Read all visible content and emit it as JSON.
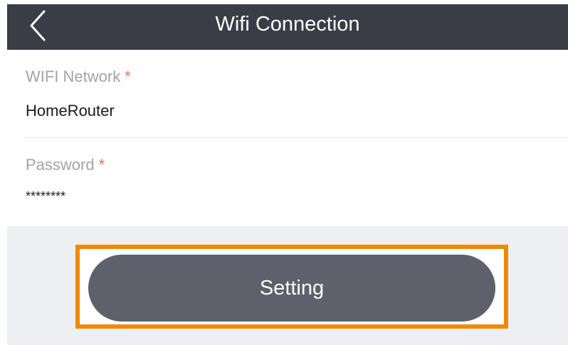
{
  "header": {
    "title": "Wifi Connection",
    "back_icon": "chevron-left-icon",
    "background_color": "#3a3d45"
  },
  "form": {
    "wifi": {
      "label": "WIFI Network",
      "required_mark": "*",
      "value": "HomeRouter"
    },
    "password": {
      "label": "Password",
      "required_mark": "*",
      "value": "********"
    },
    "required_color": "#e8764a"
  },
  "actions": {
    "setting_label": "Setting",
    "button_color": "#5e616b",
    "highlight_color": "#f08a00"
  }
}
